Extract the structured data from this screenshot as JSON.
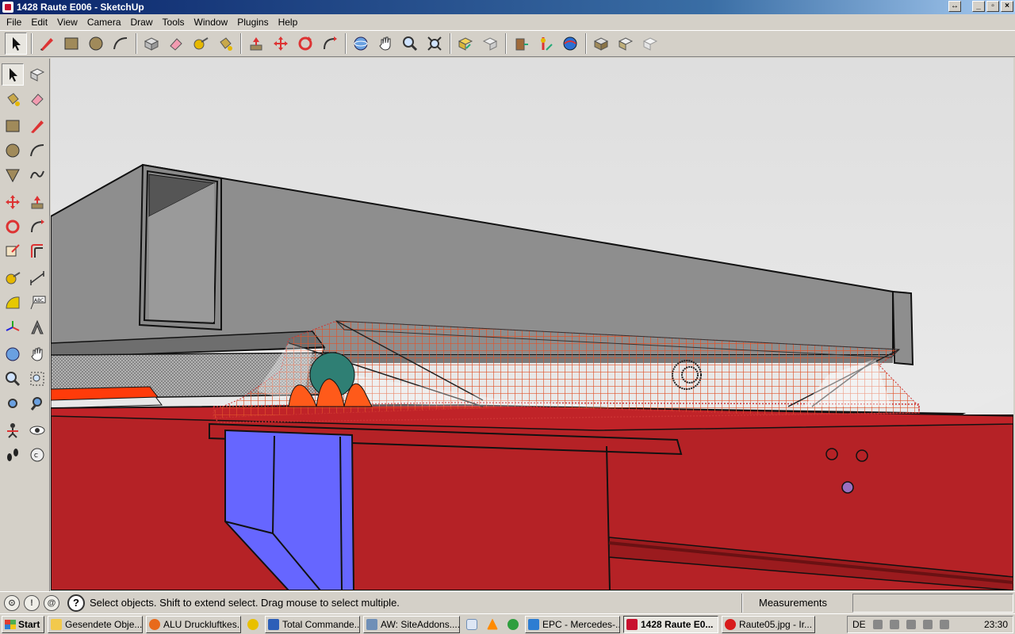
{
  "window": {
    "title": "1428 Raute E006 - SketchUp"
  },
  "menu": [
    "File",
    "Edit",
    "View",
    "Camera",
    "Draw",
    "Tools",
    "Window",
    "Plugins",
    "Help"
  ],
  "statusbar": {
    "status_text": "Select objects. Shift to extend select. Drag mouse to select multiple.",
    "measurements_label": "Measurements",
    "measurements_value": ""
  },
  "taskbar": {
    "start_label": "Start",
    "tasks": [
      {
        "label": "Gesendete Obje...",
        "icon_color": "#f2c94c"
      },
      {
        "label": "ALU Druckluftkes...",
        "icon_color": "#e86a1b"
      },
      {
        "label": "Total Commande...",
        "icon_color": "#2d5fb8"
      },
      {
        "label": "AW: SiteAddons....",
        "icon_color": "#6f8fb7"
      },
      {
        "label": "EPC - Mercedes-...",
        "icon_color": "#2d7dd2"
      },
      {
        "label": "1428 Raute E0...",
        "icon_color": "#c8102e"
      },
      {
        "label": "Raute05.jpg - Ir...",
        "icon_color": "#d81b1b"
      }
    ],
    "tray_language": "DE",
    "clock": "23:30"
  },
  "colors": {
    "sky": "#e2e2e2",
    "beam_gray": "#8e8e8e",
    "frame_red": "#b52226",
    "plate_blue": "#6666ff",
    "mesh_orange": "#e0532a"
  }
}
